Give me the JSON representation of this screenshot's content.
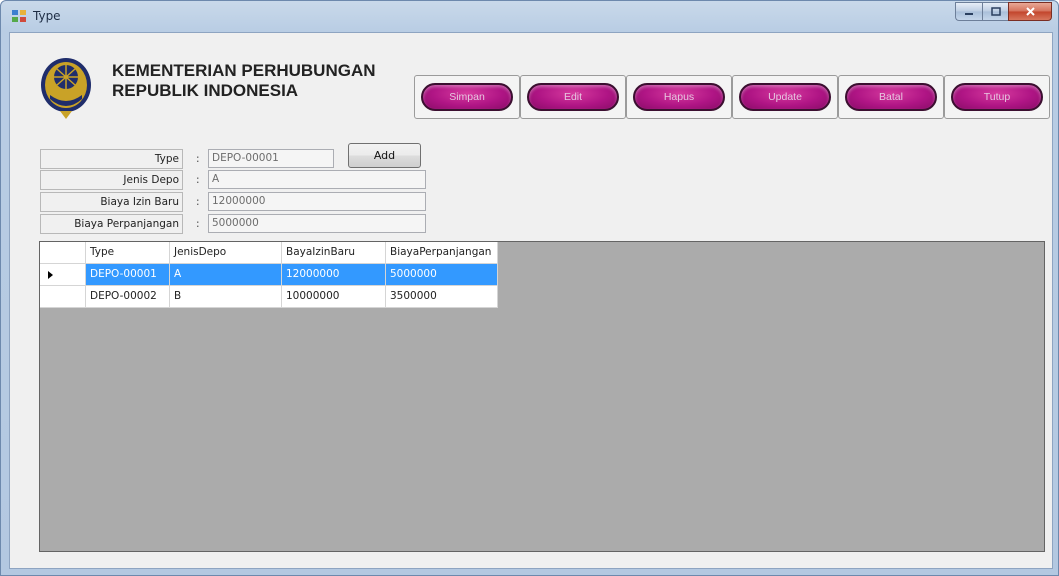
{
  "window": {
    "title": "Type",
    "colors": {
      "accent_button": "#b01585",
      "selection": "#3399ff",
      "close_button": "#c2442b"
    }
  },
  "header": {
    "org_line1": "KEMENTERIAN PERHUBUNGAN",
    "org_line2": "REPUBLIK INDONESIA",
    "logo_icon": "ministry-emblem-icon"
  },
  "toolbar": {
    "buttons": [
      {
        "label": "Simpan",
        "mnemonic": "S"
      },
      {
        "label": "Edit",
        "mnemonic": "E"
      },
      {
        "label": "Hapus",
        "mnemonic": "H"
      },
      {
        "label": "Update",
        "mnemonic": "U"
      },
      {
        "label": "Batal",
        "mnemonic": "B"
      },
      {
        "label": "Tutup",
        "mnemonic": "T"
      }
    ]
  },
  "form": {
    "fields": [
      {
        "label": "Type",
        "value": "DEPO-00001"
      },
      {
        "label": "Jenis Depo",
        "value": "A"
      },
      {
        "label": "Biaya Izin Baru",
        "value": "12000000"
      },
      {
        "label": "Biaya Perpanjangan",
        "value": "5000000"
      }
    ],
    "colon": ":",
    "add_label": "Add"
  },
  "grid": {
    "columns": [
      "Type",
      "JenisDepo",
      "BayaIzinBaru",
      "BiayaPerpanjangan"
    ],
    "rows": [
      {
        "cells": [
          "DEPO-00001",
          "A",
          "12000000",
          "5000000"
        ],
        "selected": true
      },
      {
        "cells": [
          "DEPO-00002",
          "B",
          "10000000",
          "3500000"
        ],
        "selected": false
      }
    ]
  }
}
